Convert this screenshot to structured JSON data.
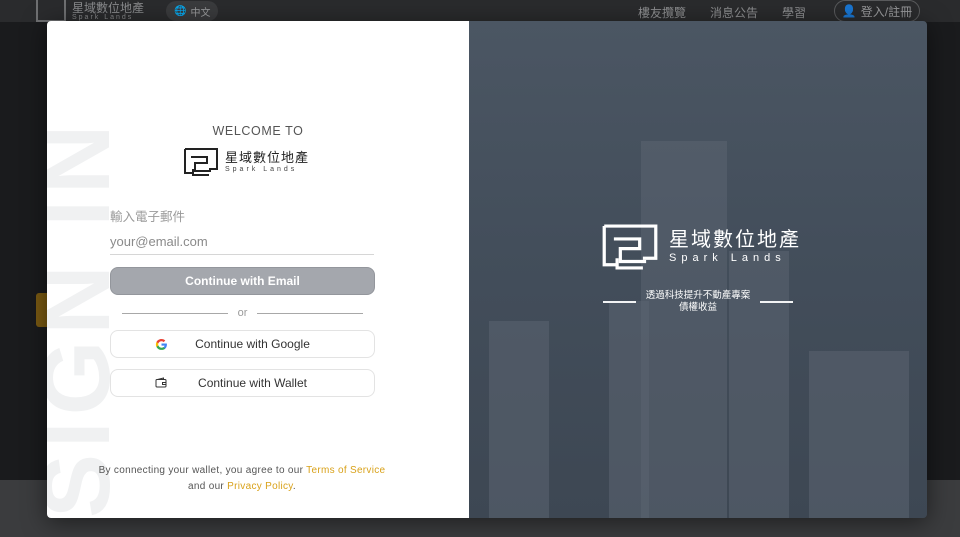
{
  "background": {
    "logo_text": "星域數位地產",
    "logo_sub": "Spark Lands",
    "lang_label": "中文",
    "nav": [
      "樓友攬覽",
      "消息公告",
      "學習"
    ],
    "login_label": "登入/註冊"
  },
  "modal": {
    "watermark": "SIGN IN",
    "welcome": "WELCOME TO",
    "brand_cn": "星域數位地產",
    "brand_en": "Spark Lands",
    "email_label": "輸入電子郵件",
    "email_placeholder": "your@email.com",
    "email_value": "",
    "continue_email": "Continue with Email",
    "or": "or",
    "continue_google": "Continue with Google",
    "continue_wallet": "Continue with Wallet",
    "terms_prefix": "By connecting your wallet, you agree to our ",
    "terms_link": "Terms of Service",
    "terms_mid": " and our ",
    "privacy_link": "Privacy Policy",
    "terms_suffix": "."
  },
  "right_panel": {
    "brand_cn": "星域數位地產",
    "brand_en": "Spark Lands",
    "tagline_line1": "透過科技提升不動產專案",
    "tagline_line2": "債權收益"
  },
  "colors": {
    "accent": "#d9a21b",
    "button_disabled": "#a4a7ad",
    "panel": "#46515e"
  }
}
